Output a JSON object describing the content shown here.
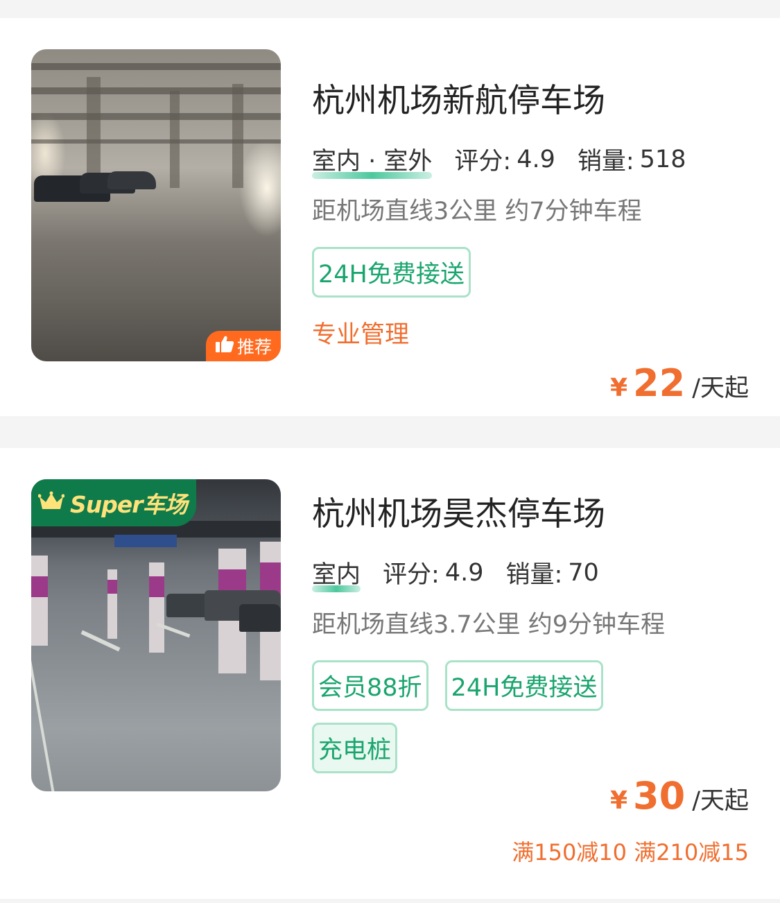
{
  "listings": [
    {
      "name": "杭州机场新航停车场",
      "location_type": "室内 · 室外",
      "rating_label": "评分:",
      "rating": "4.9",
      "sales_label": "销量:",
      "sales": "518",
      "distance": "距机场直线3公里 约7分钟车程",
      "tags": [
        "24H免费接送"
      ],
      "extra": "专业管理",
      "badge": "推荐",
      "currency": "¥",
      "price": "22",
      "price_unit": "/天起"
    },
    {
      "name": "杭州机场昊杰停车场",
      "location_type": "室内",
      "rating_label": "评分:",
      "rating": "4.9",
      "sales_label": "销量:",
      "sales": "70",
      "distance": "距机场直线3.7公里 约9分钟车程",
      "tags": [
        "会员88折",
        "24H免费接送",
        "充电桩"
      ],
      "badge": "Super车场",
      "currency": "¥",
      "price": "30",
      "price_unit": "/天起",
      "promo": "满150减10 满210减15"
    }
  ],
  "colors": {
    "accent_green": "#1aa56e",
    "price_orange": "#f06e2f",
    "super_badge_green": "#0f7a4a",
    "recommend_badge": "#ff6a1f"
  },
  "icons": {
    "thumbs_up": "thumbs-up-icon",
    "crown": "crown-icon"
  }
}
